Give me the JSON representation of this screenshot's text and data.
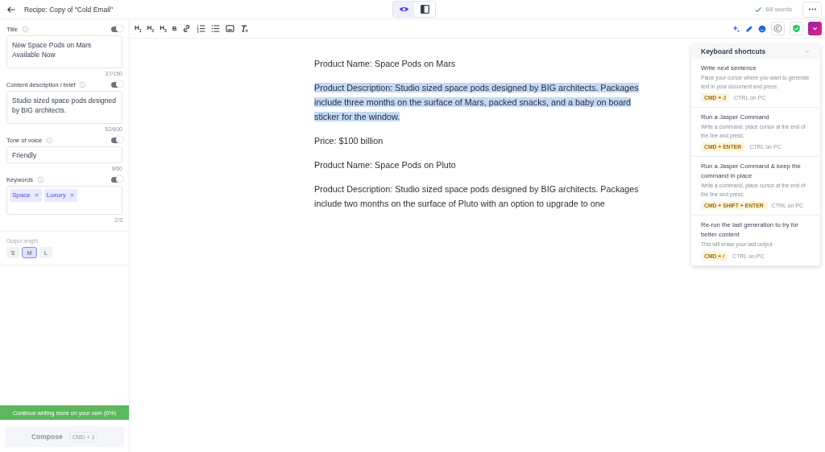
{
  "header": {
    "title": "Recipe: Copy of \"Cold Email\"",
    "view_modes": [
      {
        "kind": "preview",
        "selected": true
      },
      {
        "kind": "sidebar",
        "selected": false
      }
    ],
    "word_count": "68 words"
  },
  "sidebar": {
    "fields": [
      {
        "label": "Title",
        "kind": "textarea",
        "on": true,
        "value": "New Space Pods on Mars Available Now",
        "count": "37/150"
      },
      {
        "label": "Content description / brief",
        "kind": "textarea",
        "on": true,
        "value": "Studio sized space pods designed by BIG architects.",
        "count": "52/600"
      },
      {
        "label": "Tone of voice",
        "kind": "input",
        "on": true,
        "value": "Friendly",
        "count": "9/60"
      },
      {
        "label": "Keywords",
        "kind": "tags",
        "on": true,
        "tags": [
          "Space",
          "Luxury"
        ],
        "count": "2/3"
      }
    ],
    "output_length": {
      "label": "Output length",
      "options": [
        {
          "label": "S",
          "selected": false
        },
        {
          "label": "M",
          "selected": true
        },
        {
          "label": "L",
          "selected": false
        }
      ]
    },
    "continue_button": "Continue writing more on your own (0%)",
    "compose": {
      "label": "Compose",
      "shortcut": "CMD + J",
      "disabled": true
    }
  },
  "toolbar": [
    {
      "kind": "text",
      "label": "H$_{1}$"
    },
    {
      "kind": "text",
      "label": "H$_{2}$"
    },
    {
      "kind": "text",
      "label": "H$_{3}$"
    },
    {
      "kind": "text",
      "label": "B"
    },
    {
      "kind": "link"
    },
    {
      "kind": "ordered-list"
    },
    {
      "kind": "bullet-list"
    },
    {
      "kind": "image"
    },
    {
      "kind": "clear-format"
    }
  ],
  "document": {
    "paragraphs": [
      {
        "text": "Product Name: Space Pods on Mars",
        "selected": false
      },
      {
        "text": "Product Description: Studio sized space pods designed by BIG architects.  Packages include three months on the surface of Mars, packed snacks, and a baby on board sticker for the window.",
        "selected": true
      },
      {
        "text": "Price: $100 billion",
        "selected": false
      },
      {
        "text": "Product Name: Space Pods on Pluto",
        "selected": false
      },
      {
        "text": "Product Description: Studio sized space pods designed by BIG architects. Packages include two months on the surface of Pluto with an option to upgrade to one",
        "selected": false
      }
    ]
  },
  "shortcuts_panel": {
    "title": "Keyboard shortcuts",
    "expanded": true,
    "items": [
      {
        "title": "Write next sentence",
        "description": "Place your cursor where you want to generate text in your document and press:",
        "key": "CMD + J",
        "pc": "CTRL on PC"
      },
      {
        "title": "Run a Jasper Command",
        "description": "Write a command, place cursor at the end of the line and press:",
        "key": "CMD + ENTER",
        "pc": "CTRL on PC"
      },
      {
        "title": "Run a Jasper Command & keep the command in place",
        "description": "Write a command, place cursor at the end of the line and press:",
        "key": "CMD + SHIFT + ENTER",
        "pc": "CTRL on PC"
      },
      {
        "title": "Re-run the last generation to try for better content",
        "description": "This will erase your last output.",
        "key": "CMD + /",
        "pc": "CTRL on PC"
      }
    ]
  }
}
